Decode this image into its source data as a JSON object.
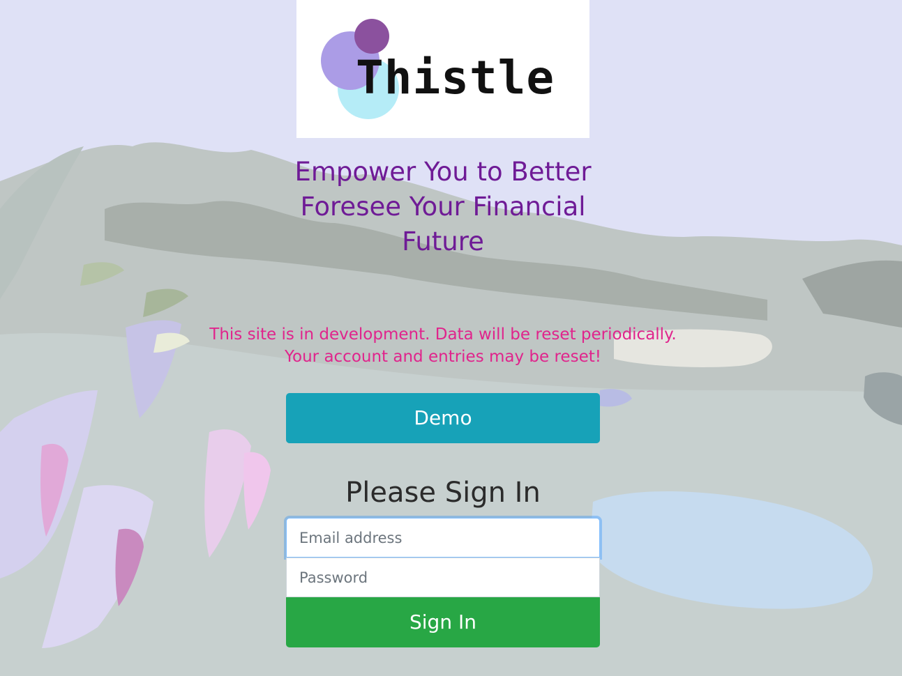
{
  "logo": {
    "wordmark": "Thistle",
    "circle_colors": [
      "#8b519e",
      "#ab9ce6",
      "#b5ecf7"
    ]
  },
  "tagline": "Empower You to Better Foresee Your Financial Future",
  "notice": {
    "line1": "This site is in development. Data will be reset periodically.",
    "line2": "Your account and entries may be reset!"
  },
  "demo_button": {
    "label": "Demo",
    "color": "#17a2b8"
  },
  "signin": {
    "title": "Please Sign In",
    "email_placeholder": "Email address",
    "password_placeholder": "Password",
    "button_label": "Sign In",
    "button_color": "#28a745"
  },
  "colors": {
    "tagline": "#6f1b96",
    "notice": "#e0248c"
  }
}
